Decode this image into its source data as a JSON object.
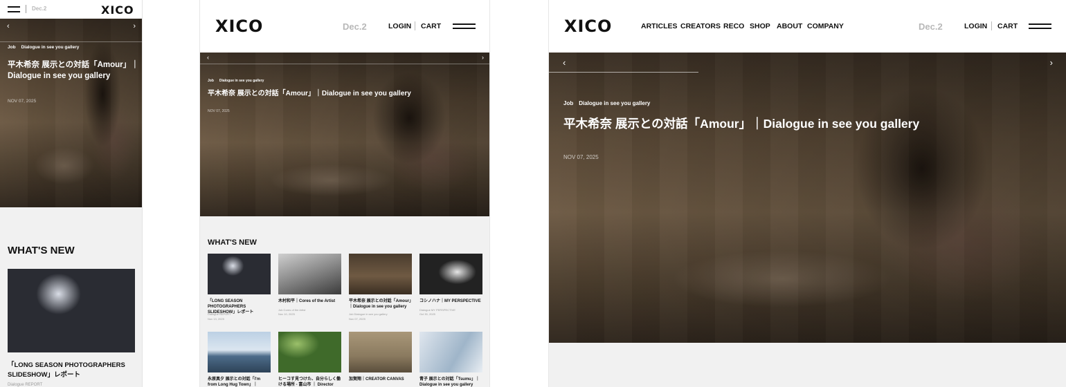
{
  "brand": {
    "logo": "XICO"
  },
  "header": {
    "date": "Dec.2",
    "login": "LOGIN",
    "cart": "CART",
    "nav": [
      "ARTICLES",
      "CREATORS",
      "RECO",
      "SHOP",
      "ABOUT",
      "COMPANY"
    ]
  },
  "hero": {
    "prev_icon": "chevron-left-icon",
    "next_icon": "chevron-right-icon",
    "category": "Job",
    "subcategory": "Dialogue in see you gallery",
    "title": "平木希奈 展示との対話「Amour」｜Dialogue in see you gallery",
    "title_line1": "平木希奈 展示との対話「Amour」｜",
    "title_line2": "Dialogue in see you gallery",
    "date": "NOV 07, 2025"
  },
  "whats_new": {
    "heading": "WHAT'S NEW",
    "articles": [
      {
        "title": "「LONG SEASON PHOTOGRAPHERS SLIDESHOW」レポート",
        "meta": "Dialogue  REPORT",
        "date": "Nov 13, 2025"
      },
      {
        "title": "木村和平｜Cores of the Artist",
        "meta": "Job  Cores of the Artist",
        "date": "Nov 10, 2025"
      },
      {
        "title": "平木希奈 展示との対話「Amour」｜Dialogue in see you gallery",
        "meta": "Job  Dialogue in see you gallery",
        "date": "Nov 07, 2025"
      },
      {
        "title": "コシノハナ｜MY PERSPECTIVE",
        "meta": "Dialogue  MY PERSPECTIVE",
        "date": "Oct 30, 2025"
      },
      {
        "title": "永原真夕 展示との対話「I'm from Long Hug Town」｜Dialogue in see you",
        "meta": "",
        "date": ""
      },
      {
        "title": "ヒーコす見つけた、自分らしく働ける場所 - 富山市 ｜ Director Interview of XICO",
        "meta": "",
        "date": ""
      },
      {
        "title": "加賀翔｜CREATOR CANVAS",
        "meta": "",
        "date": ""
      },
      {
        "title": "青子 展示との対話「Tsumu」｜Dialogue in see you gallery",
        "meta": "",
        "date": ""
      }
    ]
  },
  "mobile_first_article": {
    "title_line1": "「LONG SEASON PHOTOGRAPHERS",
    "title_line2": "SLIDESHOW」レポート",
    "meta": "Dialogue  REPORT"
  },
  "colors": {
    "accent": "#111111",
    "date_grey": "#b8b8b8",
    "background": "#f1f1f1"
  }
}
